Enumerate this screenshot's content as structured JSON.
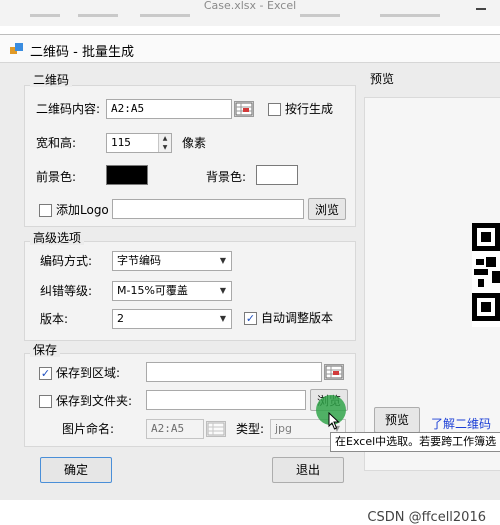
{
  "excel_window": {
    "title": "Case.xlsx  -  Excel"
  },
  "dialog": {
    "title": "二维码 - 批量生成"
  },
  "qrcode_group": {
    "legend": "二维码",
    "content_label": "二维码内容:",
    "content_value": "A2:A5",
    "by_row_label": "按行生成",
    "by_row_checked": false,
    "size_label": "宽和高:",
    "size_value": "115",
    "size_unit": "像素",
    "fg_label": "前景色:",
    "fg_color": "#000000",
    "bg_label": "背景色:",
    "bg_color": "#ffffff",
    "logo_label": "添加Logo",
    "logo_checked": false,
    "logo_path": "",
    "browse_label": "浏览"
  },
  "advanced_group": {
    "legend": "高级选项",
    "encoding_label": "编码方式:",
    "encoding_value": "字节编码",
    "ecc_label": "纠错等级:",
    "ecc_value": "M-15%可覆盖",
    "version_label": "版本:",
    "version_value": "2",
    "auto_version_label": "自动调整版本",
    "auto_version_checked": true
  },
  "save_group": {
    "legend": "保存",
    "to_range_label": "保存到区域:",
    "to_range_checked": true,
    "to_range_value": "",
    "to_folder_label": "保存到文件夹:",
    "to_folder_checked": false,
    "to_folder_value": "",
    "browse_label": "浏览",
    "image_name_label": "图片命名:",
    "image_name_value": "A2:A5",
    "type_label": "类型:",
    "type_value": "jpg"
  },
  "preview": {
    "legend": "预览",
    "button_label": "预览",
    "learn_link": "了解二维码"
  },
  "tooltip": {
    "text": "在Excel中选取。若要跨工作簿选"
  },
  "buttons": {
    "ok": "确定",
    "exit": "退出"
  },
  "watermark": {
    "text": "CSDN @ffcell2016"
  },
  "colors": {
    "accent": "#1b3fd6",
    "highlight": "#32a54b"
  }
}
